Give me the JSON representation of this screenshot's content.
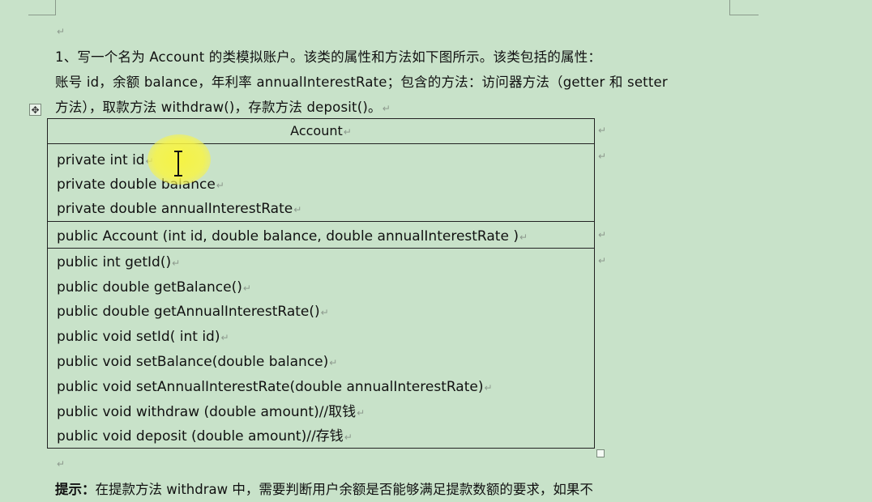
{
  "paragraph_mark": "↵",
  "cell_mark": "↵",
  "move_handle_icon": "move-icon",
  "intro": {
    "line1": "1、写一个名为 Account 的类模拟账户。该类的属性和方法如下图所示。该类包括的属性：",
    "line2": "账号 id，余额 balance，年利率 annualInterestRate；包含的方法：访问器方法（getter 和 setter",
    "line3": "方法），取款方法 withdraw()，存款方法 deposit()。"
  },
  "uml": {
    "class_name": "Account",
    "attributes": [
      "private int id",
      "private double balance",
      "private double annualInterestRate"
    ],
    "constructor": "public Account (int id, double balance, double annualInterestRate )",
    "methods": [
      "public int getId()",
      "public double getBalance()",
      "public double getAnnualInterestRate()",
      "public void setId( int id)",
      "public void setBalance(double balance)",
      "public void setAnnualInterestRate(double annualInterestRate)",
      "public void withdraw (double amount)//取钱",
      "public void deposit (double amount)//存钱"
    ]
  },
  "tip": {
    "label": "提示：",
    "text": "在提款方法 withdraw 中，需要判断用户余额是否能够满足提款数额的要求，如果不"
  }
}
